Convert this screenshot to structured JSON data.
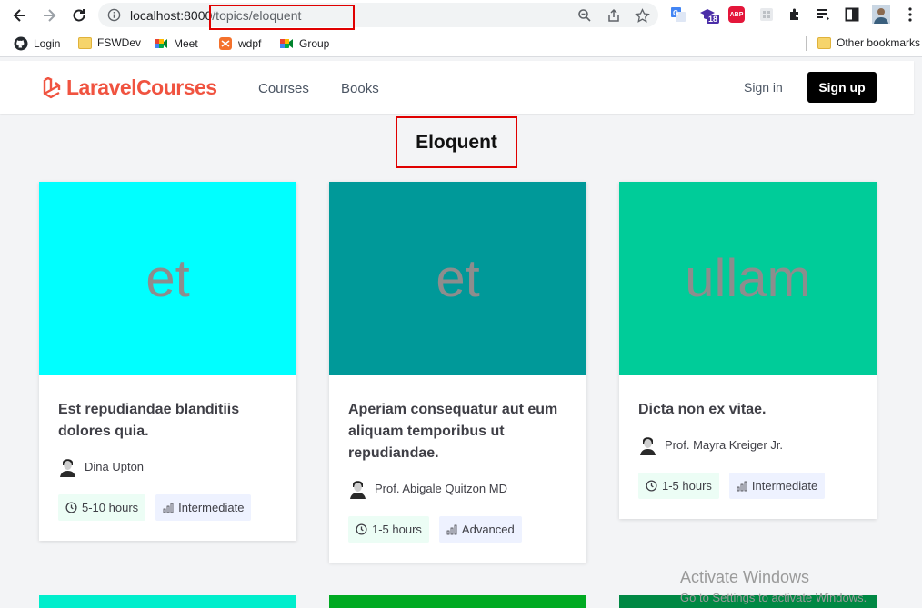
{
  "browser": {
    "url_host": "localhost:8000",
    "url_path": "/topics/eloquent",
    "extension_badge": "18",
    "abp_label": "ABP",
    "bookmarks": [
      {
        "label": "Login",
        "icon": "github-icon"
      },
      {
        "label": "FSWDev",
        "icon": "folder-icon"
      },
      {
        "label": "Meet",
        "icon": "meet-icon"
      },
      {
        "label": "wdpf",
        "icon": "wdpf-icon"
      },
      {
        "label": "Group",
        "icon": "meet-icon"
      }
    ],
    "other_bookmarks": "Other bookmarks"
  },
  "header": {
    "logo_part1": "Laravel",
    "logo_part2": "Courses",
    "nav": [
      "Courses",
      "Books"
    ],
    "signin": "Sign in",
    "signup": "Sign up"
  },
  "page": {
    "title": "Eloquent"
  },
  "courses": [
    {
      "image_text": "et",
      "image_color": "#00ffff",
      "title": "Est repudiandae blanditiis dolores quia.",
      "author": "Dina Upton",
      "duration": "5-10 hours",
      "level": "Intermediate"
    },
    {
      "image_text": "et",
      "image_color": "#009999",
      "title": "Aperiam consequatur aut eum aliquam temporibus ut repudiandae.",
      "author": "Prof. Abigale Quitzon MD",
      "duration": "1-5 hours",
      "level": "Advanced"
    },
    {
      "image_text": "ullam",
      "image_color": "#00cc99",
      "title": "Dicta non ex vitae.",
      "author": "Prof. Mayra Kreiger Jr.",
      "duration": "1-5 hours",
      "level": "Intermediate"
    }
  ],
  "next_row_colors": [
    "#00eecc",
    "#00aa22",
    "#008844"
  ],
  "watermark": {
    "line1": "Activate Windows",
    "line2": "Go to Settings to activate Windows."
  }
}
